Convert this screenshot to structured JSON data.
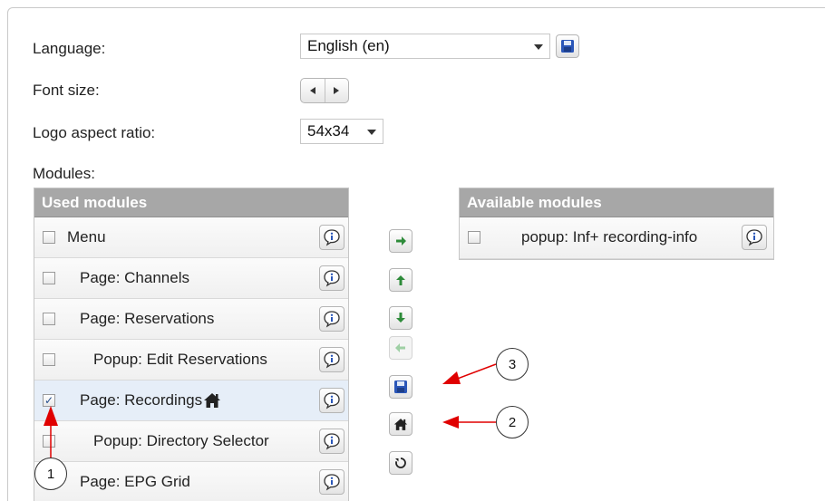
{
  "settings": {
    "language_label": "Language:",
    "language_value": "English (en)",
    "font_size_label": "Font size:",
    "logo_ratio_label": "Logo aspect ratio:",
    "logo_ratio_value": "54x34",
    "modules_label": "Modules:"
  },
  "used_modules": {
    "header": "Used modules",
    "items": [
      {
        "label": "Menu",
        "checked": false
      },
      {
        "label": "Page: Channels",
        "checked": false
      },
      {
        "label": "Page: Reservations",
        "checked": false
      },
      {
        "label": "Popup: Edit Reservations",
        "checked": false
      },
      {
        "label": "Page: Recordings",
        "checked": true,
        "home": true
      },
      {
        "label": "Popup: Directory Selector",
        "checked": false
      },
      {
        "label": "Page: EPG Grid",
        "checked": false
      }
    ]
  },
  "available_modules": {
    "header": "Available modules",
    "items": [
      {
        "label": "popup: Inf+ recording-info",
        "checked": false
      }
    ]
  },
  "callouts": [
    "1",
    "2",
    "3"
  ],
  "colors": {
    "header_bg": "#a7a7a7",
    "arrow_green": "#2e8b3a",
    "annotation_red": "#e00000",
    "save_blue": "#2a56b8"
  },
  "icons": [
    "dropdown-arrow-icon",
    "save-icon",
    "info-icon",
    "arrow-right-icon",
    "arrow-up-icon",
    "arrow-down-icon",
    "arrow-left-icon",
    "home-icon",
    "refresh-icon"
  ]
}
